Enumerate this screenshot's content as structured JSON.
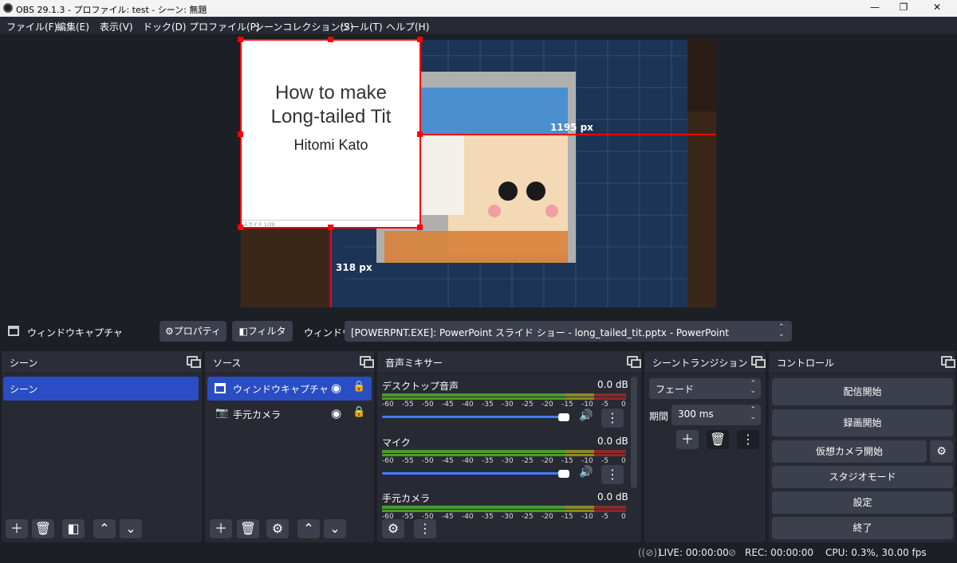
{
  "window": {
    "title": "OBS 29.1.3 - プロファイル: test - シーン: 無題"
  },
  "menu": [
    "ファイル(F)",
    "編集(E)",
    "表示(V)",
    "ドック(D)",
    "プロファイル(P)",
    "シーンコレクション(S)",
    "ツール(T)",
    "ヘルプ(H)"
  ],
  "preview": {
    "slide_title_line1": "How to make",
    "slide_title_line2": "Long-tailed Tit",
    "slide_author": "Hitomi Kato",
    "slide_footer": "スライド 1/30",
    "dim_right": "1195 px",
    "dim_bottom": "318 px"
  },
  "source_bar": {
    "selected_source": "ウィンドウキャプチャ",
    "properties_label": "プロパティ",
    "filters_label": "フィルタ",
    "window_label": "ウィンドウ",
    "window_value": "[POWERPNT.EXE]: PowerPoint スライド ショー  -  long_tailed_tit.pptx - PowerPoint"
  },
  "scenes": {
    "title": "シーン",
    "items": [
      "シーン"
    ]
  },
  "sources": {
    "title": "ソース",
    "items": [
      "ウィンドウキャプチャ",
      "手元カメラ"
    ]
  },
  "mixer": {
    "title": "音声ミキサー",
    "scale": [
      "-60",
      "-55",
      "-50",
      "-45",
      "-40",
      "-35",
      "-30",
      "-25",
      "-20",
      "-15",
      "-10",
      "-5",
      "0"
    ],
    "channels": [
      {
        "name": "デスクトップ音声",
        "db": "0.0 dB",
        "volume": 1.0
      },
      {
        "name": "マイク",
        "db": "0.0 dB",
        "volume": 1.0
      },
      {
        "name": "手元カメラ",
        "db": "0.0 dB",
        "volume": 1.0
      }
    ]
  },
  "transitions": {
    "title": "シーントランジション",
    "type": "フェード",
    "duration_label": "期間",
    "duration_value": "300 ms"
  },
  "controls": {
    "title": "コントロール",
    "start_streaming": "配信開始",
    "start_recording": "録画開始",
    "start_virtualcam": "仮想カメラ開始",
    "studio_mode": "スタジオモード",
    "settings": "設定",
    "exit": "終了"
  },
  "status": {
    "live": "LIVE: 00:00:00",
    "rec": "REC: 00:00:00",
    "cpu": "CPU: 0.3%, 30.00 fps"
  },
  "colors": {
    "accent": "#2a4dc4",
    "selection_red": "#ff0000",
    "slider": "#3d7fff",
    "meter_green": "#4c9a2a",
    "meter_yellow": "#8a8a24",
    "meter_red": "#8a2a2a"
  }
}
